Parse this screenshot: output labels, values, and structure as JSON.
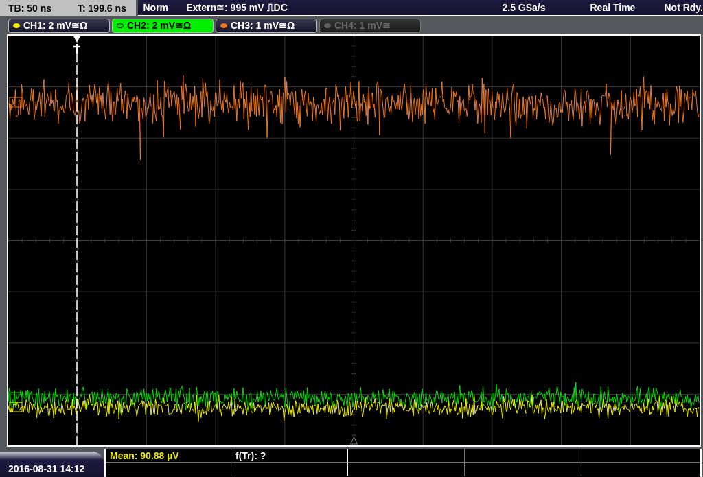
{
  "timebase": {
    "tb": "TB: 50 ns",
    "t": "T: 199.6 ns"
  },
  "status": {
    "mode": "Norm",
    "trigger": "Extern≅: 995 mV ⎍DC",
    "rate": "2.5 GSa/s",
    "acquisition": "Real Time",
    "state": "Not Rdy."
  },
  "channels": [
    {
      "label": "CH1: 2 mV≅Ω",
      "color": "#f0f000",
      "selected": false,
      "enabled": true
    },
    {
      "label": "CH2: 2 mV≅Ω",
      "color": "#00e000",
      "selected": true,
      "enabled": true
    },
    {
      "label": "CH3: 1 mV≅Ω",
      "color": "#f07820",
      "selected": false,
      "enabled": true
    },
    {
      "label": "CH4: 1 mV≅",
      "color": "#606060",
      "selected": false,
      "enabled": false
    }
  ],
  "date": "2016-08-31 14:12",
  "measurements": [
    {
      "text": "Mean: 90.88 µV",
      "color": "#f0f000"
    },
    {
      "text": "f(Tr): ?",
      "color": "#ffffff"
    }
  ]
}
